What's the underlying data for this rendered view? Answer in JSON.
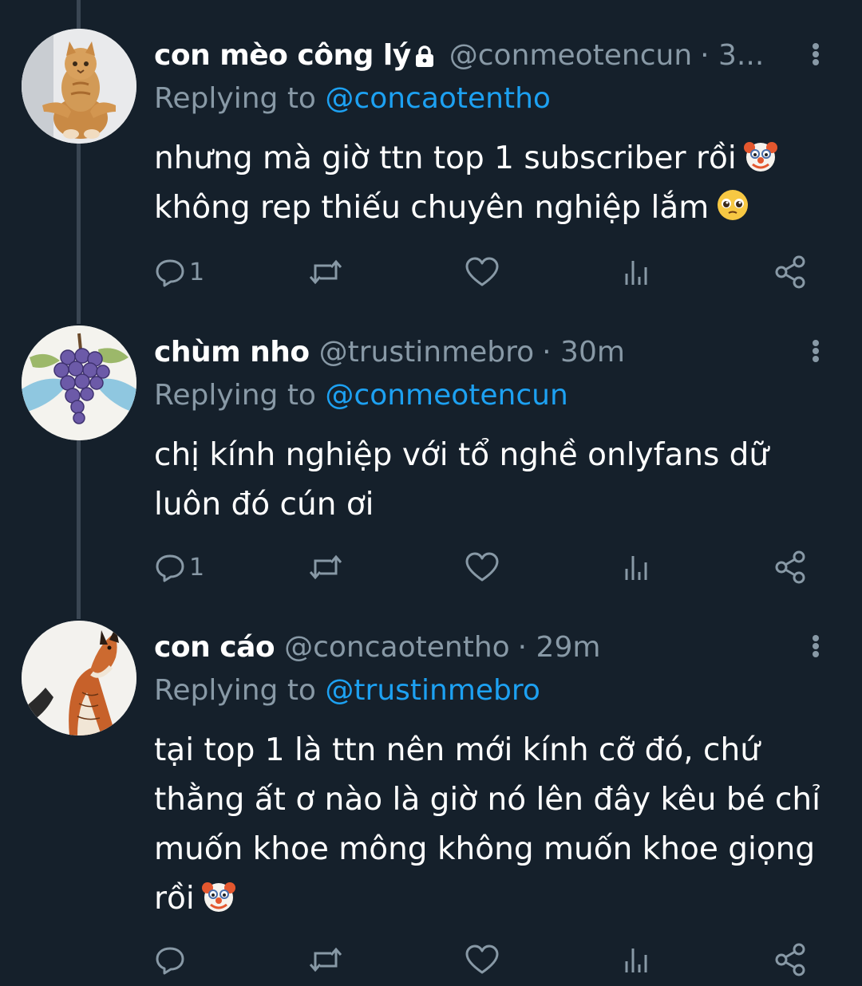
{
  "tweets": [
    {
      "name": "con mèo công lý",
      "protected": true,
      "handle": "@conmeotencun",
      "time": "· 3...",
      "replying_prefix": "Replying to ",
      "replying_to": "@concaotentho",
      "lines": [
        "nhưng mà giờ ttn top 1 subscriber rồi",
        "không rep thiếu chuyên nghiệp lắm"
      ],
      "line_emojis": [
        "clown-face-emoji",
        "pleading-face-emoji"
      ],
      "reply_count": "1",
      "avatar": "cat-avatar"
    },
    {
      "name": "chùm nho",
      "protected": false,
      "handle": "@trustinmebro",
      "time": "· 30m",
      "replying_prefix": "Replying to ",
      "replying_to": "@conmeotencun",
      "lines": [
        "chị kính nghiệp với tổ nghề onlyfans dữ",
        "luôn đó cún ơi"
      ],
      "line_emojis": [
        "",
        ""
      ],
      "reply_count": "1",
      "avatar": "grapes-avatar"
    },
    {
      "name": "con cáo",
      "protected": false,
      "handle": "@concaotentho",
      "time": "· 29m",
      "replying_prefix": "Replying to ",
      "replying_to": "@trustinmebro",
      "lines": [
        "tại top 1 là ttn nên mới kính cỡ đó, chứ",
        "thằng ất ơ nào là giờ nó lên đây kêu bé chỉ",
        "muốn khoe mông không muốn khoe giọng",
        "rồi"
      ],
      "line_emojis": [
        "",
        "",
        "",
        "clown-face-emoji"
      ],
      "reply_count": "",
      "avatar": "fox-avatar"
    }
  ],
  "icons": [
    "reply-icon",
    "retweet-icon",
    "like-icon",
    "analytics-icon",
    "share-icon",
    "more-icon",
    "lock-icon"
  ],
  "colors": {
    "background": "#15202b",
    "text": "#ffffff",
    "secondary": "#8899a6",
    "link": "#1da1f2",
    "thread_line": "#3a4653"
  }
}
